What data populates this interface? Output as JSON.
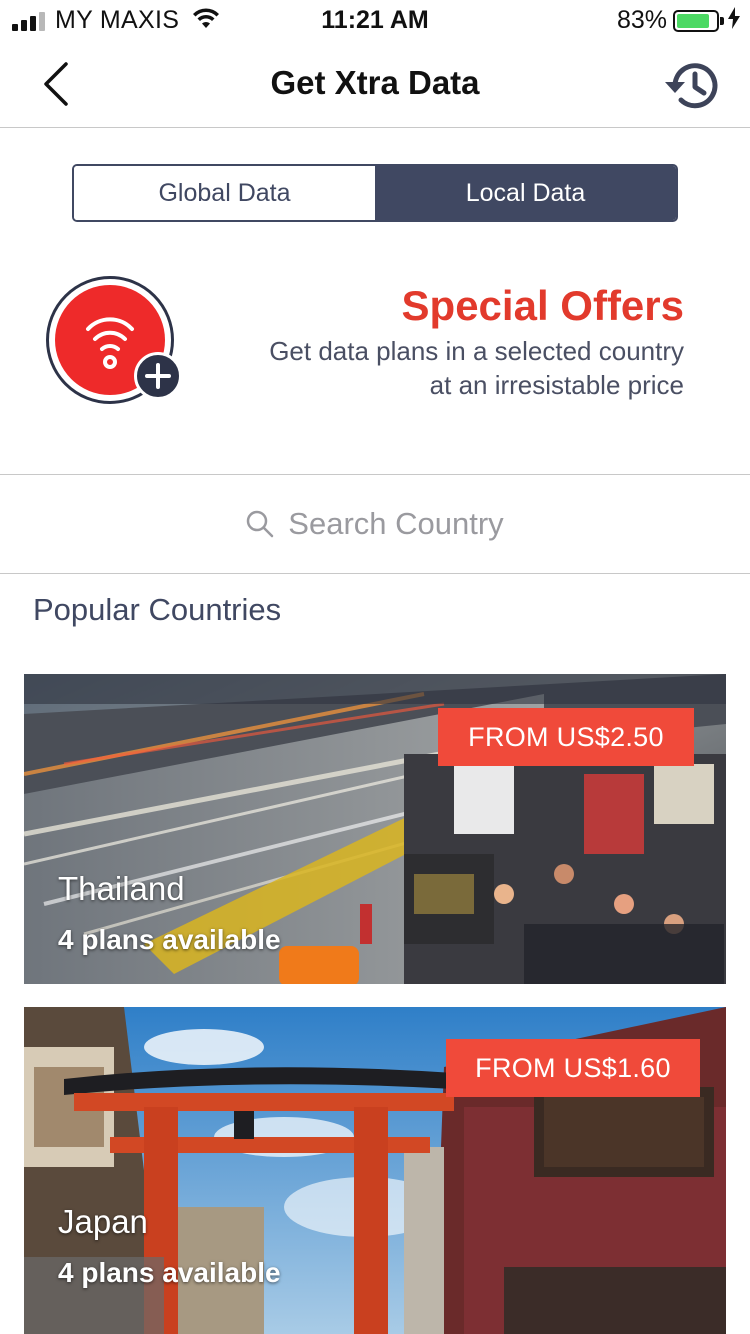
{
  "status_bar": {
    "carrier": "MY MAXIS",
    "time": "11:21 AM",
    "battery_percent": "83%",
    "battery_level": 0.83,
    "signal_bars": 4,
    "signal_bars_filled": 3,
    "battery_color": "#4cd964"
  },
  "nav": {
    "back_icon": "chevron-left-icon",
    "title": "Get Xtra Data",
    "history_icon": "history-clock-icon"
  },
  "tabs": [
    {
      "label": "Global Data",
      "selected": false
    },
    {
      "label": "Local Data",
      "selected": true
    }
  ],
  "offer": {
    "icon": "wifi-plus-icon",
    "title": "Special Offers",
    "description": "Get data plans in a selected country at an irresistable price"
  },
  "search": {
    "icon": "search-icon",
    "placeholder": "Search Country"
  },
  "popular": {
    "title": "Popular Countries",
    "items": [
      {
        "country": "Thailand",
        "plans": "4 plans available",
        "price": "FROM US$2.50"
      },
      {
        "country": "Japan",
        "plans": "4 plans available",
        "price": "FROM US$1.60"
      }
    ]
  },
  "colors": {
    "accent_navy": "#404862",
    "offer_red": "#e23a2c",
    "badge_red": "#f04a3a"
  }
}
